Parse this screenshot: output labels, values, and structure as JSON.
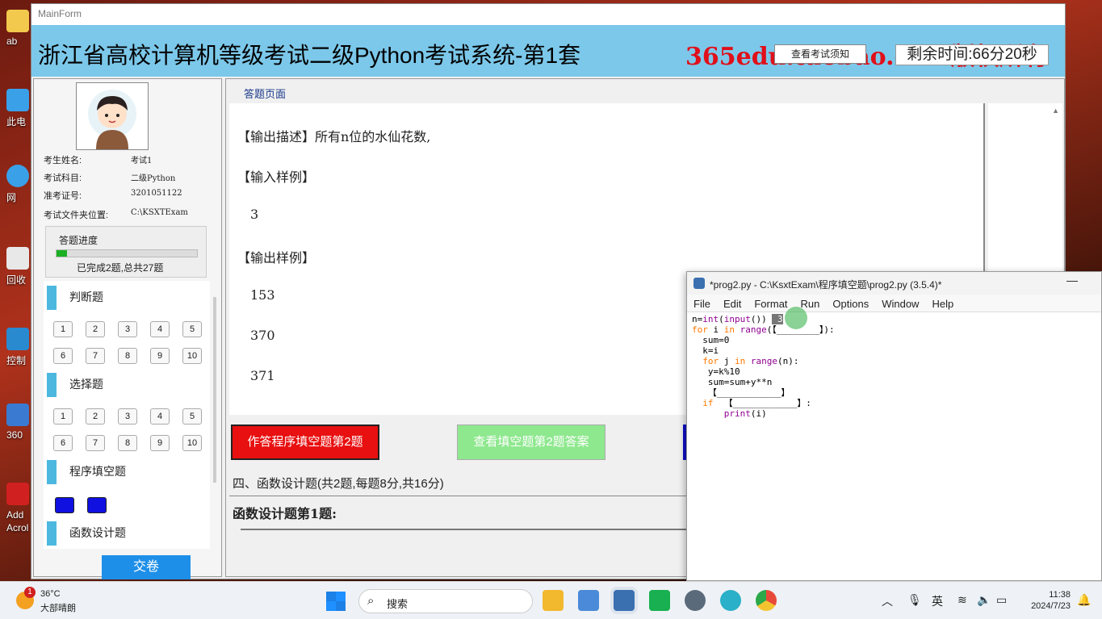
{
  "desktop": {
    "icons": [
      {
        "label": "ab",
        "icon": "folder-icon",
        "color": "#f2c94c"
      },
      {
        "label": "此电",
        "icon": "computer-icon",
        "color": "#3aa0e8"
      },
      {
        "label": "网",
        "icon": "network-icon",
        "color": "#3aa0e8"
      },
      {
        "label": "回收",
        "icon": "recycle-bin-icon",
        "color": "#e8e8e8"
      },
      {
        "label": "控制",
        "icon": "control-panel-icon",
        "color": "#2a8ad0"
      },
      {
        "label": "360",
        "icon": "zip-icon",
        "color": "#3a7ad0"
      },
      {
        "label": "Add Acrol",
        "icon": "acrobat-icon",
        "color": "#d02020"
      }
    ]
  },
  "main_form": {
    "window_title": "MainForm",
    "header_title": "浙江省高校计算机等级考试二级Python考试系统-第1套",
    "watermark": "365edu.taobao.com版权所有",
    "notice_button": "查看考试须知",
    "timer": "剩余时间:66分20秒"
  },
  "candidate": {
    "name_label": "考生姓名:",
    "name_value": "考试1",
    "subject_label": "考试科目:",
    "subject_value": "二级Python",
    "id_label": "准考证号:",
    "id_value": "3201051122",
    "folder_label": "考试文件夹位置:",
    "folder_value": "C:\\KSXTExam"
  },
  "progress": {
    "label": "答题进度",
    "fraction": 0.074,
    "text": "已完成2题,总共27题"
  },
  "sections": {
    "judge": "判断题",
    "choice": "选择题",
    "fill": "程序填空题",
    "func": "函数设计题",
    "judge_nums": [
      "1",
      "2",
      "3",
      "4",
      "5",
      "6",
      "7",
      "8",
      "9",
      "10"
    ],
    "choice_nums": [
      "1",
      "2",
      "3",
      "4",
      "5",
      "6",
      "7",
      "8",
      "9",
      "10"
    ]
  },
  "submit_button": "交卷",
  "answer_page": {
    "tab": "答题页面",
    "lines": [
      "【输出描述】所有n位的水仙花数,",
      "【输入样例】",
      "3",
      "【输出样例】",
      "153",
      "370",
      "371"
    ],
    "answer_button": "作答程序填空题第2题",
    "view_answer_button": "查看填空题第2题答案",
    "section4_heading": "四、函数设计题(共2题,每题8分,共16分)",
    "func_question_title": "函数设计题第1题:"
  },
  "idle": {
    "title": "*prog2.py - C:\\KsxtExam\\程序填空题\\prog2.py (3.5.4)*",
    "minimize": "—",
    "menu": [
      "File",
      "Edit",
      "Format",
      "Run",
      "Options",
      "Window",
      "Help"
    ],
    "code": {
      "l1a": "n=",
      "l1b": "int",
      "l1c": "(",
      "l1d": "input",
      "l1e": "()) ",
      "l1sel": " 3",
      "l2a": "for",
      "l2b": " i ",
      "l2c": "in",
      "l2d": " ",
      "l2e": "range",
      "l2f": "(【________】):",
      "l3": "  sum=0",
      "l4": "  k=i",
      "l5a": "  ",
      "l5b": "for",
      "l5c": " j ",
      "l5d": "in",
      "l5e": " ",
      "l5f": "range",
      "l5g": "(n):",
      "l6": "   y=k%10",
      "l7": "   sum=sum+y**n",
      "l8": "   【____________】",
      "l9a": "  ",
      "l9b": "if",
      "l9c": "  【____________】:",
      "l10a": "      ",
      "l10b": "print",
      "l10c": "(i)"
    }
  },
  "taskbar": {
    "badge": "1",
    "temperature": "36°C",
    "condition": "大部晴朗",
    "search_placeholder": "搜索",
    "ime": "英",
    "time": "11:38",
    "date": "2024/7/23",
    "apps": [
      {
        "icon": "file-explorer-icon",
        "color": "#f2b82e"
      },
      {
        "icon": "photos-icon",
        "color": "#4a8ad8"
      },
      {
        "icon": "python-idle-icon",
        "color": "#3a6fb0"
      },
      {
        "icon": "wechat-store-icon",
        "color": "#18b050"
      },
      {
        "icon": "settings-icon",
        "color": "#5a6a7a"
      },
      {
        "icon": "edge-app-icon",
        "color": "#2ab0c8"
      },
      {
        "icon": "chrome-icon",
        "color": "#e84a3a"
      }
    ]
  }
}
